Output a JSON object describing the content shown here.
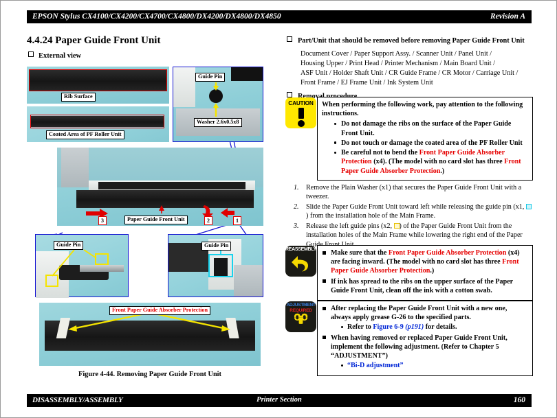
{
  "header": {
    "left": "EPSON Stylus CX4100/CX4200/CX4700/CX4800/DX4200/DX4800/DX4850",
    "right": "Revision A"
  },
  "footer": {
    "left": "DISASSEMBLY/ASSEMBLY",
    "center": "Printer Section",
    "right": "160"
  },
  "section": {
    "number_title": "4.4.24  Paper Guide Front Unit",
    "external_view_label": "External view"
  },
  "right_column": {
    "parts_heading": "Part/Unit that should be removed before removing Paper Guide Front Unit",
    "parts_lines": [
      "Document Cover / Paper Support Assy. / Scanner Unit / Panel Unit /",
      "Housing Upper / Print Head / Printer Mechanism / Main Board Unit /",
      "ASF Unit / Holder Shaft Unit / CR Guide Frame / CR Motor / Carriage Unit /",
      "Front Frame / EJ Frame Unit / Ink System Unit"
    ],
    "removal_heading": "Removal procedure"
  },
  "caution": {
    "icon_label": "CAUTION",
    "intro": "When performing the following work, pay attention to the following instructions.",
    "bullets": [
      {
        "text": "Do not damage the ribs on the surface of the Paper Guide Front Unit."
      },
      {
        "text": "Do not touch or damage the coated area of the PF Roller Unit"
      },
      {
        "pre": "Be careful not to bend the ",
        "red1": "Front Paper Guide Absorber Protection",
        "mid": " (x4). (The model with no card slot has three ",
        "red2": "Front Paper Guide Absorber Protection",
        "post": ".)"
      }
    ]
  },
  "steps": [
    {
      "n": "1.",
      "text": "Remove the Plain Washer (x1) that secures the Paper Guide Front Unit with a tweezer."
    },
    {
      "n": "2.",
      "pre": "Slide the Paper Guide Front Unit toward left while releasing the guide pin (x1, ",
      "marker": "cyan-square-marker",
      "post": ") from the installation hole of the Main Frame."
    },
    {
      "n": "3.",
      "pre": "Release the left guide pins (x2, ",
      "marker": "yellow-square-marker",
      "post": ") of the Paper Guide Front Unit from the installation holes of the Main Frame while lowering the right end of the Paper Guide Front Unit."
    }
  ],
  "reassembly": {
    "icon_label": "REASSEMBLY",
    "items": [
      {
        "pre": "Make sure that the ",
        "red1": "Front Paper Guide Absorber Protection",
        "mid": " (x4) are facing inward. (The model with no card slot has three ",
        "red2": "Front Paper Guide Absorber Protection",
        "post": ".)"
      },
      {
        "text": "If ink has spread to the ribs on the upper surface of the Paper Guide Front Unit, clean off the ink with a cotton swab."
      }
    ]
  },
  "adjustment": {
    "icon_label_line1": "ADJUSTMENT",
    "icon_label_line2": "REQUIRED",
    "item1": "After replacing the Paper Guide Front Unit with a new one, always apply grease G-26 to the specified parts.",
    "item1_sub_pre": "Refer to ",
    "item1_sub_link": "Figure 6-9",
    "item1_sub_page": "(p191)",
    "item1_sub_post": " for details.",
    "item2": "When having removed or replaced Paper Guide Front Unit, implement the following adjustment. (Refer to Chapter 5 “ADJUSTMENT”)",
    "item2_sub": "“Bi-D adjustment”"
  },
  "figure": {
    "caption": "Figure 4-44.  Removing Paper Guide Front Unit",
    "labels": {
      "rib_surface": "Rib Surface",
      "coated_area": "Coated Area of PF Roller Unit",
      "guide_pin_top": "Guide Pin",
      "washer": "Washer 2.6x0.5x8",
      "paper_guide_front_unit": "Paper Guide Front Unit",
      "guide_pin_left": "Guide Pin",
      "guide_pin_right": "Guide Pin",
      "absorber_protection": "Front Paper Guide Absorber Protection"
    },
    "step_markers": [
      "1",
      "2",
      "3"
    ]
  },
  "colors": {
    "caution_yellow": "#ffe800",
    "icon_black": "#1a1a15",
    "alert_red": "#e60000",
    "link_blue": "#0026d6",
    "panel_border_blue": "#1414d2",
    "highlight_yellow": "#f5e400",
    "highlight_cyan": "#18d2ec"
  }
}
